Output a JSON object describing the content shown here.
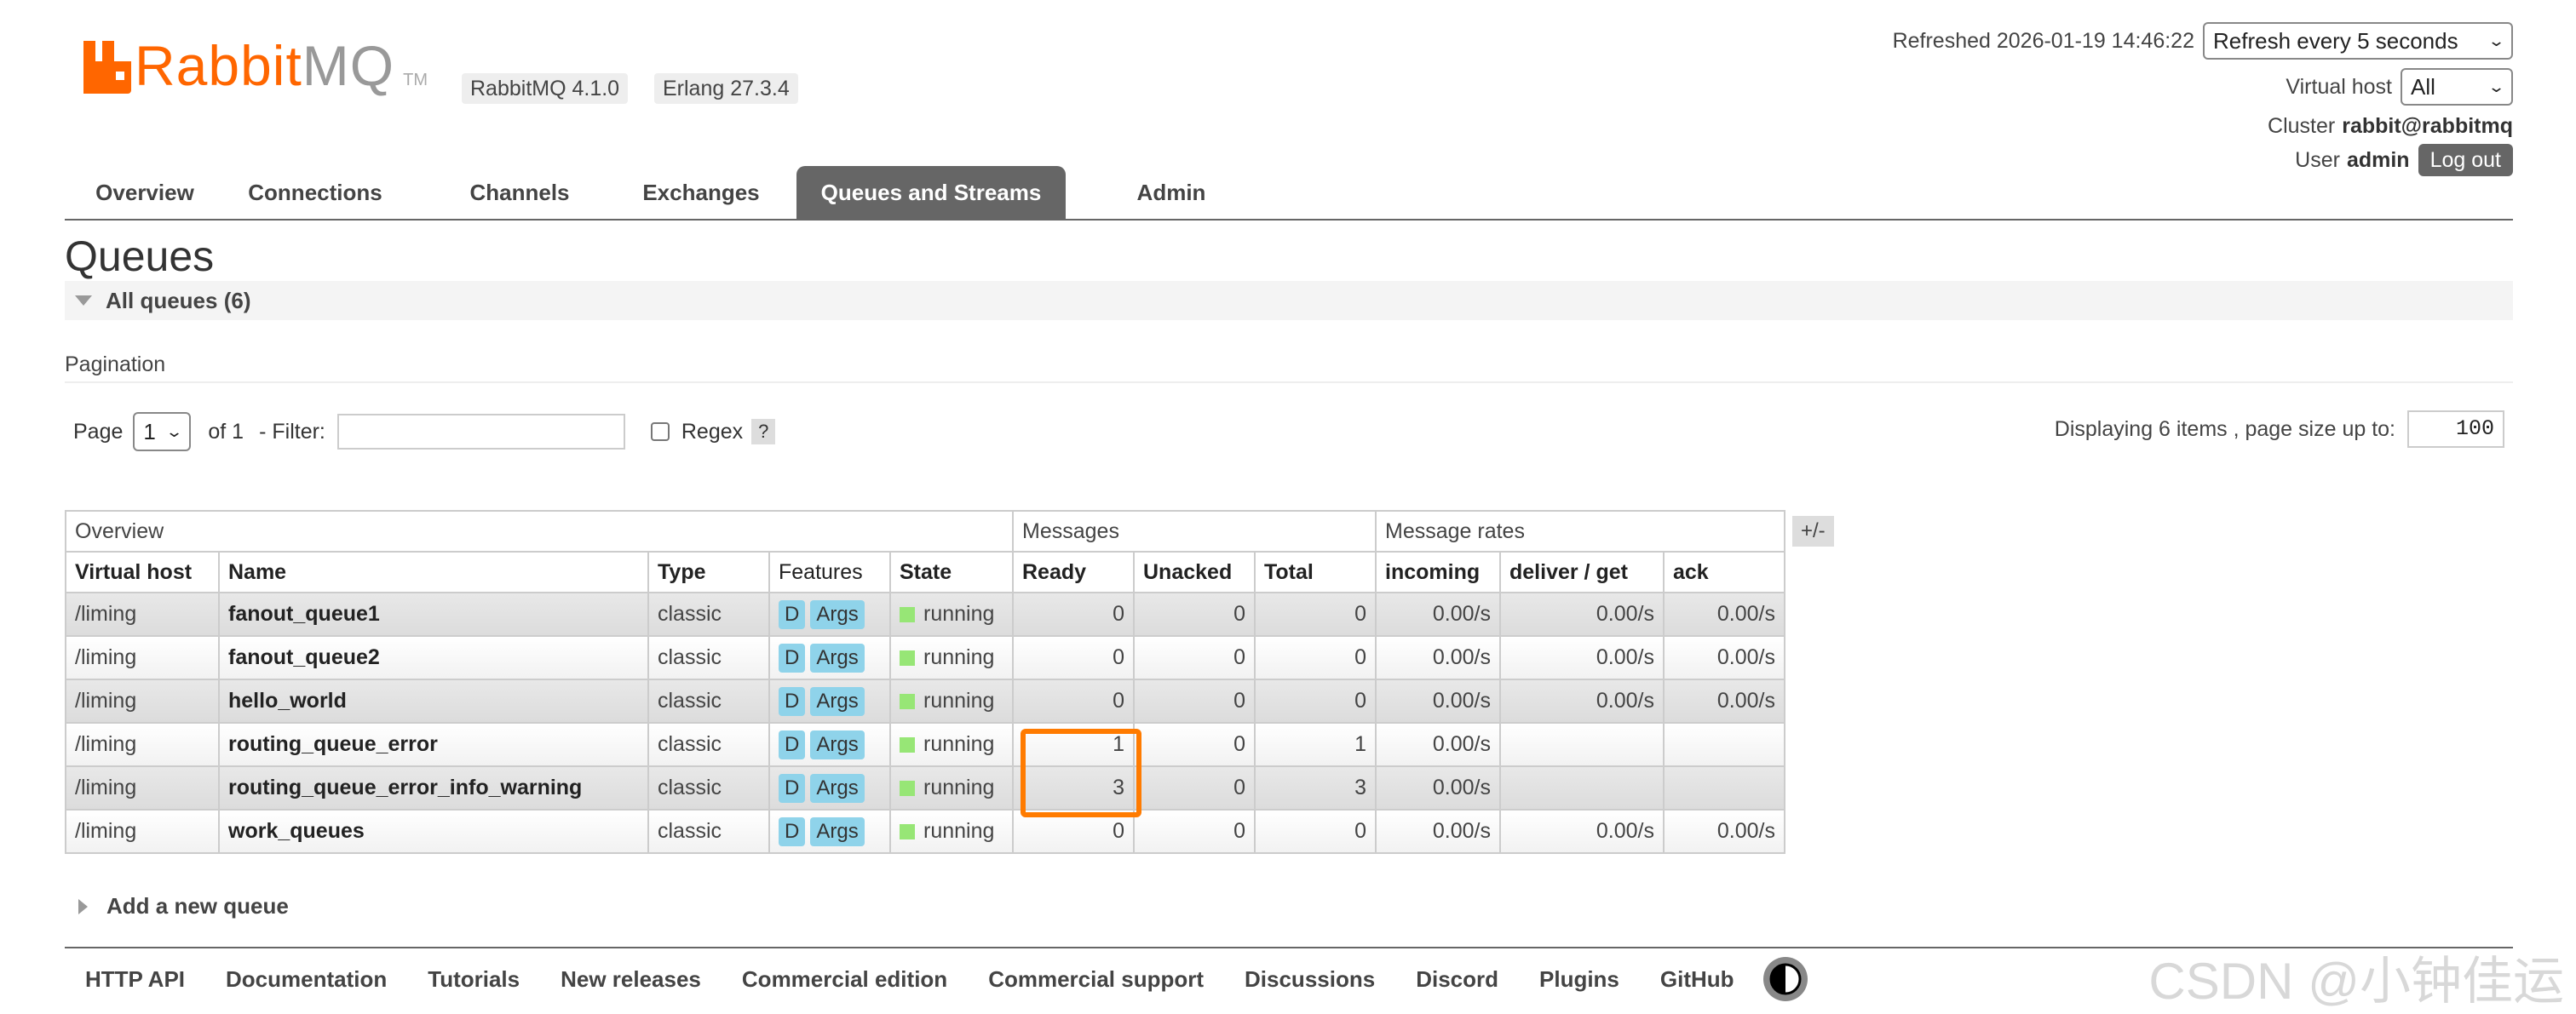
{
  "header": {
    "logo_text_rabbit": "Rabbit",
    "logo_text_mq": "MQ",
    "logo_tm": "TM",
    "rabbitmq_version": "RabbitMQ 4.1.0",
    "erlang_version": "Erlang 27.3.4",
    "refreshed_label": "Refreshed 2026-01-19 14:46:22",
    "refresh_select": "Refresh every 5 seconds",
    "vhost_label": "Virtual host",
    "vhost_select": "All",
    "cluster_label": "Cluster",
    "cluster_value": "rabbit@rabbitmq",
    "user_label": "User",
    "user_value": "admin",
    "logout_label": "Log out"
  },
  "nav": {
    "tabs": [
      {
        "label": "Overview"
      },
      {
        "label": "Connections"
      },
      {
        "label": "Channels"
      },
      {
        "label": "Exchanges"
      },
      {
        "label": "Queues and Streams"
      },
      {
        "label": "Admin"
      }
    ],
    "active": "Queues and Streams"
  },
  "main": {
    "title": "Queues",
    "section_label": "All queues (6)",
    "pagination_label": "Pagination",
    "page_label": "Page",
    "page_value": "1",
    "of_label": "of 1",
    "filter_label": "- Filter:",
    "filter_value": "",
    "regex_label": "Regex",
    "help_label": "?",
    "displaying_label": "Displaying 6 items , page size up to:",
    "page_size": "100",
    "plusminus_label": "+/-",
    "add_queue_label": "Add a new queue"
  },
  "table": {
    "groups": {
      "overview": "Overview",
      "messages": "Messages",
      "rates": "Message rates"
    },
    "columns": {
      "vhost": "Virtual host",
      "name": "Name",
      "type": "Type",
      "features": "Features",
      "state": "State",
      "ready": "Ready",
      "unacked": "Unacked",
      "total": "Total",
      "incoming": "incoming",
      "deliver": "deliver / get",
      "ack": "ack"
    },
    "feature_d": "D",
    "feature_args": "Args",
    "rows": [
      {
        "vhost": "/liming",
        "name": "fanout_queue1",
        "type": "classic",
        "state": "running",
        "ready": "0",
        "unacked": "0",
        "total": "0",
        "incoming": "0.00/s",
        "deliver": "0.00/s",
        "ack": "0.00/s"
      },
      {
        "vhost": "/liming",
        "name": "fanout_queue2",
        "type": "classic",
        "state": "running",
        "ready": "0",
        "unacked": "0",
        "total": "0",
        "incoming": "0.00/s",
        "deliver": "0.00/s",
        "ack": "0.00/s"
      },
      {
        "vhost": "/liming",
        "name": "hello_world",
        "type": "classic",
        "state": "running",
        "ready": "0",
        "unacked": "0",
        "total": "0",
        "incoming": "0.00/s",
        "deliver": "0.00/s",
        "ack": "0.00/s"
      },
      {
        "vhost": "/liming",
        "name": "routing_queue_error",
        "type": "classic",
        "state": "running",
        "ready": "1",
        "unacked": "0",
        "total": "1",
        "incoming": "0.00/s",
        "deliver": "",
        "ack": ""
      },
      {
        "vhost": "/liming",
        "name": "routing_queue_error_info_warning",
        "type": "classic",
        "state": "running",
        "ready": "3",
        "unacked": "0",
        "total": "3",
        "incoming": "0.00/s",
        "deliver": "",
        "ack": ""
      },
      {
        "vhost": "/liming",
        "name": "work_queues",
        "type": "classic",
        "state": "running",
        "ready": "0",
        "unacked": "0",
        "total": "0",
        "incoming": "0.00/s",
        "deliver": "0.00/s",
        "ack": "0.00/s"
      }
    ]
  },
  "footer": {
    "links": [
      "HTTP API",
      "Documentation",
      "Tutorials",
      "New releases",
      "Commercial edition",
      "Commercial support",
      "Discussions",
      "Discord",
      "Plugins",
      "GitHub"
    ]
  },
  "watermark": "CSDN @小钟佳运",
  "colors": {
    "brand": "#ff6600",
    "highlight": "#ff7b00",
    "running": "#97e676",
    "feature_badge": "#8fd3ea"
  }
}
